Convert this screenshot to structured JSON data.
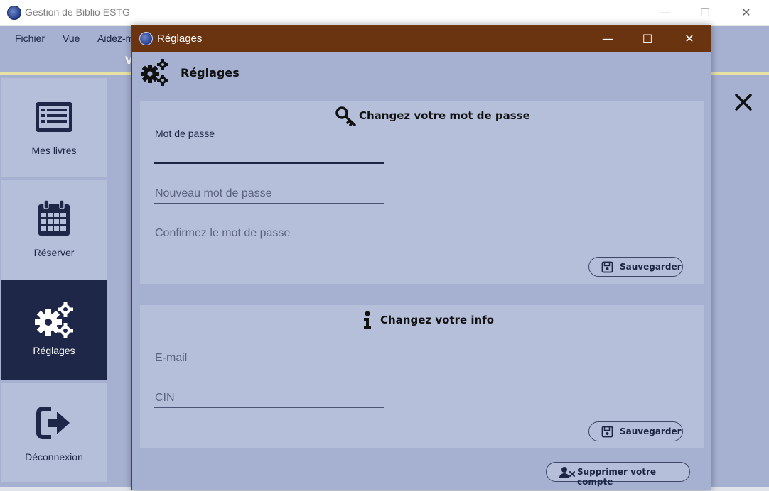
{
  "main_window": {
    "title": "Gestion de Biblio ESTG",
    "menu": [
      "Fichier",
      "Vue",
      "Aidez-m"
    ],
    "menu_fragment": "V",
    "controls": {
      "minimize": "—",
      "maximize": "☐",
      "close": "✕"
    }
  },
  "sidebar": {
    "items": [
      {
        "label": "Mes livres",
        "icon": "book-list-icon"
      },
      {
        "label": "Réserver",
        "icon": "calendar-icon"
      },
      {
        "label": "Réglages",
        "icon": "gears-icon",
        "active": true
      },
      {
        "label": "Déconnexion",
        "icon": "sign-out-icon"
      }
    ]
  },
  "dialog": {
    "title": "Réglages",
    "controls": {
      "minimize": "—",
      "maximize": "☐",
      "close": "✕"
    },
    "header_title": "Réglages",
    "password_section": {
      "title": "Changez votre mot de passe",
      "icon": "key-icon",
      "current_label": "Mot de passe",
      "current_value": "",
      "new_placeholder": "Nouveau mot de passe",
      "confirm_placeholder": "Confirmez le mot de passe",
      "save_label": "Sauvegarder"
    },
    "info_section": {
      "title": "Changez votre info",
      "icon": "info-icon",
      "email_placeholder": "E-mail",
      "cin_placeholder": "CIN",
      "save_label": "Sauvegarder"
    },
    "delete_label": "Supprimer votre compte"
  },
  "colors": {
    "sidebar_bg": "#a6b0d0",
    "sidebar_item_bg": "#b6bfd9",
    "sidebar_active": "#1e2747",
    "dialog_titlebar": "#6b3410",
    "panel_bg": "#b6bfd9",
    "text_dark": "#1d2545"
  }
}
